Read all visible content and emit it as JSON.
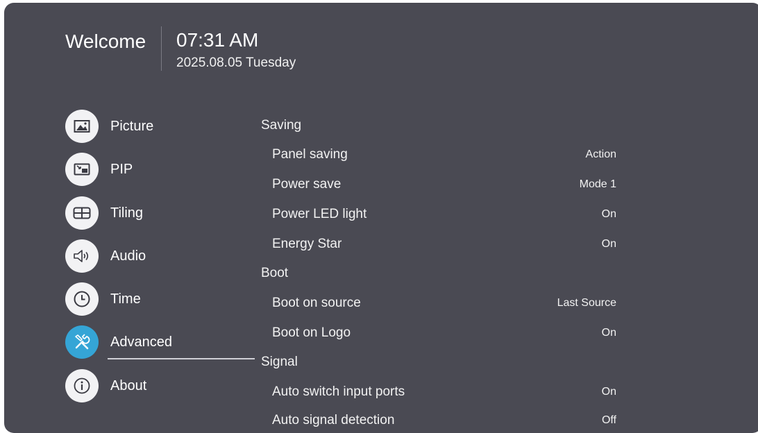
{
  "header": {
    "welcome": "Welcome",
    "time": "07:31 AM",
    "date": "2025.08.05 Tuesday"
  },
  "menu": [
    {
      "label": "Picture",
      "icon": "picture-icon",
      "active": false
    },
    {
      "label": "PIP",
      "icon": "pip-icon",
      "active": false
    },
    {
      "label": "Tiling",
      "icon": "tiling-icon",
      "active": false
    },
    {
      "label": "Audio",
      "icon": "speaker-icon",
      "active": false
    },
    {
      "label": "Time",
      "icon": "clock-icon",
      "active": false
    },
    {
      "label": "Advanced",
      "icon": "tools-icon",
      "active": true
    },
    {
      "label": "About",
      "icon": "info-icon",
      "active": false
    }
  ],
  "settings": {
    "saving": {
      "title": "Saving",
      "items": [
        {
          "label": "Panel saving",
          "value": "Action"
        },
        {
          "label": "Power save",
          "value": "Mode 1"
        },
        {
          "label": "Power LED light",
          "value": "On"
        },
        {
          "label": "Energy Star",
          "value": "On"
        }
      ]
    },
    "boot": {
      "title": "Boot",
      "items": [
        {
          "label": "Boot on source",
          "value": "Last Source"
        },
        {
          "label": "Boot on Logo",
          "value": "On"
        }
      ]
    },
    "signal": {
      "title": "Signal",
      "items": [
        {
          "label": "Auto switch input ports",
          "value": "On"
        },
        {
          "label": "Auto signal detection",
          "value": "Off"
        }
      ]
    }
  },
  "colors": {
    "panel": "#4a4a53",
    "accent": "#35a5d6",
    "icon_bg": "#f2f2f4"
  }
}
